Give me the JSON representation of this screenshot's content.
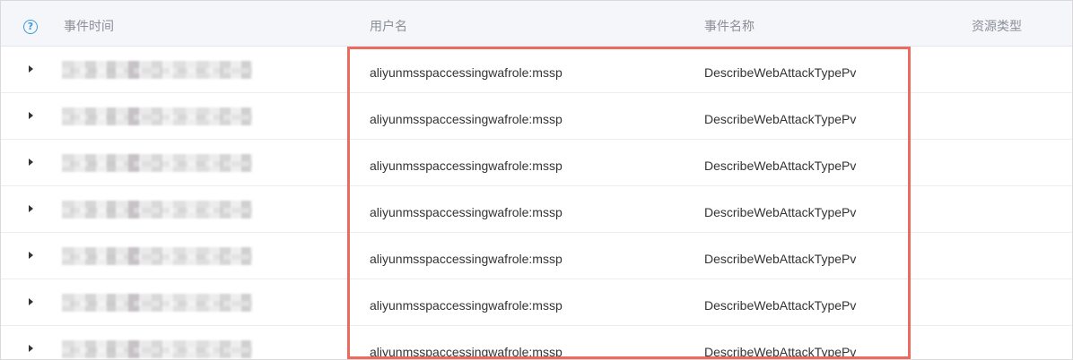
{
  "table": {
    "columns": {
      "event_time": "事件时间",
      "username": "用户名",
      "event_name": "事件名称",
      "resource_type": "资源类型"
    },
    "help_icon_glyph": "?",
    "rows": [
      {
        "username": "aliyunmsspaccessingwafrole:mssp",
        "event_name": "DescribeWebAttackTypePv"
      },
      {
        "username": "aliyunmsspaccessingwafrole:mssp",
        "event_name": "DescribeWebAttackTypePv"
      },
      {
        "username": "aliyunmsspaccessingwafrole:mssp",
        "event_name": "DescribeWebAttackTypePv"
      },
      {
        "username": "aliyunmsspaccessingwafrole:mssp",
        "event_name": "DescribeWebAttackTypePv"
      },
      {
        "username": "aliyunmsspaccessingwafrole:mssp",
        "event_name": "DescribeWebAttackTypePv"
      },
      {
        "username": "aliyunmsspaccessingwafrole:mssp",
        "event_name": "DescribeWebAttackTypePv"
      },
      {
        "username": "aliyunmsspaccessingwafrole:mssp",
        "event_name": "DescribeWebAttackTypePv"
      }
    ]
  },
  "icons": {
    "help": "question-circle-icon",
    "expand": "caret-right-icon"
  },
  "colors": {
    "accent": "#3a9bdc",
    "highlight": "#ec6a5e",
    "header_bg": "#f4f6f9"
  }
}
